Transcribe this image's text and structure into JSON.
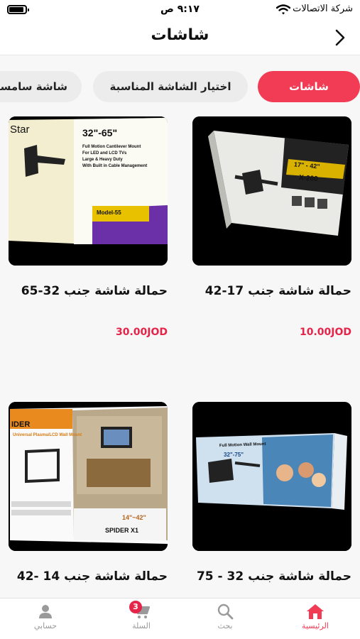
{
  "status_bar": {
    "time": "٩:١٧ ص",
    "carrier": "شركة الاتصالات"
  },
  "header": {
    "title": "شاشات"
  },
  "tabs": [
    {
      "label": "شاشات",
      "active": true
    },
    {
      "label": "اختيار الشاشة المناسبة",
      "active": false
    },
    {
      "label": "شاشة سامسونج",
      "active": false
    }
  ],
  "products": [
    {
      "name": "حمالة شاشة جنب 17-42",
      "price": "10.00JOD",
      "box_text": {
        "size": "17\" - 42\"",
        "model": "X-200"
      }
    },
    {
      "name": "حمالة شاشة جنب 32-65",
      "price": "30.00JOD",
      "box_text": {
        "brand": "Star",
        "size": "32\"-65\"",
        "line1": "Full Motion Cantilever Mount",
        "line2": "For LED and LCD TVs",
        "line3": "Large & Heavy Duty",
        "line4": "With Built in Cable Management",
        "model": "Model-55"
      }
    },
    {
      "name": "حمالة شاشة جنب 32 - 75",
      "price": "",
      "box_text": {
        "line1": "Full Motion Wall Mount",
        "size": "32\"-75\""
      }
    },
    {
      "name": "حمالة شاشة جنب 14 -42",
      "price": "",
      "box_text": {
        "brand": "IDER",
        "line1": "Universal Plasma/LCD Wall Mount",
        "size": "14\"~42\"",
        "model": "SPIDER X1"
      }
    }
  ],
  "bottom_nav": [
    {
      "label": "الرئيسية",
      "icon": "home-icon",
      "active": true
    },
    {
      "label": "بحث",
      "icon": "search-icon",
      "active": false
    },
    {
      "label": "السلة",
      "icon": "cart-icon",
      "active": false,
      "badge": "3"
    },
    {
      "label": "حسابي",
      "icon": "user-icon",
      "active": false
    }
  ],
  "colors": {
    "accent": "#f23c55",
    "price": "#e5244a",
    "background": "#f7f7f7"
  }
}
